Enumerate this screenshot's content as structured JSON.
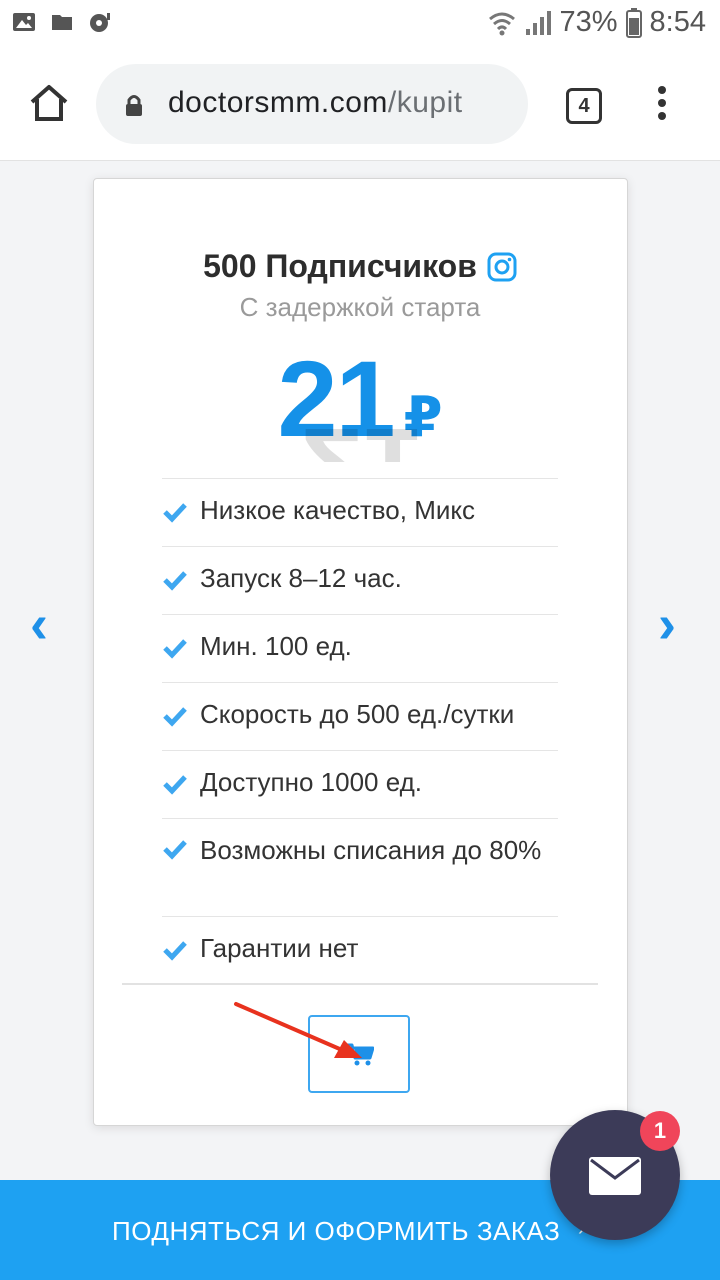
{
  "status_bar": {
    "battery": "73%",
    "time": "8:54"
  },
  "browser": {
    "url_domain": "doctorsmm.com",
    "url_path": "/kupit",
    "tab_count": "4"
  },
  "nav": {
    "prev": "‹",
    "next": "›"
  },
  "card": {
    "title": "500 Подписчиков",
    "subtitle": "С задержкой старта",
    "price": "21",
    "currency": "₽",
    "features": [
      "Низкое качество, Микс",
      "Запуск 8–12 час.",
      "Мин. 100 ед.",
      "Скорость до 500 ед./сутки",
      "Доступно 1000 ед.",
      "Возможны списания до 80%",
      "Гарантии нет"
    ]
  },
  "bottom_bar": {
    "label": "ПОДНЯТЬСЯ И ОФОРМИТЬ ЗАКАЗ"
  },
  "chat": {
    "badge": "1"
  },
  "colors": {
    "accent": "#1591e8",
    "bottom_bar": "#1ea1f2",
    "chat_fab": "#3c3b58",
    "badge": "#f0455a",
    "annotation_arrow": "#e8321e"
  },
  "icons": {
    "status": [
      "gallery-icon",
      "folder-icon",
      "media-icon",
      "wifi-icon",
      "signal-icon",
      "battery-icon"
    ],
    "toolbar": [
      "home-icon",
      "lock-icon",
      "tabs-icon",
      "menu-icon"
    ],
    "card": [
      "instagram-icon",
      "check-icon",
      "cart-icon"
    ],
    "fab": [
      "mail-icon"
    ]
  }
}
